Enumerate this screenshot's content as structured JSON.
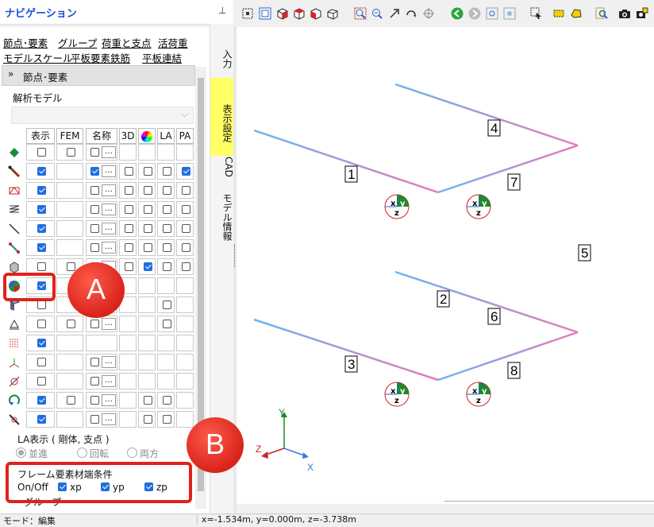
{
  "nav": {
    "title": "ナビゲーション",
    "pin": "ª",
    "menu": [
      "節点･要素",
      "グループ",
      "荷重と支点",
      "活荷重",
      "モデルスケール",
      "平板要素鉄筋",
      "平板連結"
    ],
    "section_title": "節点･要素",
    "model_label": "解析モデル",
    "model_value": "",
    "columns": [
      "表示",
      "FEM",
      "名称",
      "3D",
      "",
      "LA",
      "PA"
    ],
    "rows": [
      {
        "icon": "node-icon",
        "disp": false,
        "fem": false,
        "name": false,
        "threed": null,
        "color": null,
        "la": null,
        "pa": null
      },
      {
        "icon": "frame-element-icon",
        "disp": true,
        "fem": null,
        "name": true,
        "threed": false,
        "color": false,
        "la": false,
        "pa": true
      },
      {
        "icon": "truss-icon",
        "disp": true,
        "fem": null,
        "name": false,
        "threed": false,
        "color": false,
        "la": false,
        "pa": false
      },
      {
        "icon": "spring-icon",
        "disp": true,
        "fem": null,
        "name": false,
        "threed": false,
        "color": false,
        "la": false,
        "pa": false
      },
      {
        "icon": "cable-icon",
        "disp": true,
        "fem": null,
        "name": false,
        "threed": false,
        "color": false,
        "la": false,
        "pa": false
      },
      {
        "icon": "link-icon",
        "disp": true,
        "fem": null,
        "name": false,
        "threed": false,
        "color": false,
        "la": false,
        "pa": false
      },
      {
        "icon": "solid-icon",
        "disp": false,
        "fem": false,
        "name": false,
        "threed": false,
        "color": true,
        "la": false,
        "pa": false
      },
      {
        "icon": "local-axis-icon",
        "disp": true,
        "fem": null,
        "name": null,
        "threed": null,
        "color": null,
        "la": null,
        "pa": null
      },
      {
        "icon": "plate-icon",
        "disp": false,
        "fem": null,
        "name": null,
        "threed": null,
        "color": null,
        "la": false,
        "pa": null
      },
      {
        "icon": "support-icon",
        "disp": false,
        "fem": false,
        "name": false,
        "threed": null,
        "color": null,
        "la": false,
        "pa": null
      },
      {
        "icon": "spring-support-icon",
        "disp": true,
        "fem": null,
        "name": null,
        "threed": null,
        "color": null,
        "la": null,
        "pa": null
      },
      {
        "icon": "axis-icon",
        "disp": false,
        "fem": null,
        "name": false,
        "threed": null,
        "color": null,
        "la": null,
        "pa": null
      },
      {
        "icon": "rigid-icon",
        "disp": false,
        "fem": null,
        "name": false,
        "threed": null,
        "color": null,
        "la": null,
        "pa": null
      },
      {
        "icon": "rotation-icon",
        "disp": true,
        "fem": false,
        "name": false,
        "threed": null,
        "color": false,
        "la": false,
        "pa": null
      },
      {
        "icon": "release-icon",
        "disp": true,
        "fem": null,
        "name": false,
        "threed": null,
        "color": false,
        "la": false,
        "pa": null
      }
    ],
    "la_title": "LA表示 ( 剛体, 支点 )",
    "la_options": [
      "並進",
      "回転",
      "両方"
    ],
    "frame_title": "フレーム要素材端条件",
    "frame_onoff": "On/Off",
    "frame_options": [
      "xp",
      "yp",
      "zp"
    ],
    "next_section": "グループ",
    "vtabs": [
      "入力",
      "表示設定",
      "CAD",
      "モデル情報"
    ]
  },
  "callouts": [
    "A",
    "B"
  ],
  "canvas": {
    "members": [
      "1",
      "2",
      "3",
      "4",
      "5",
      "6",
      "7",
      "8"
    ],
    "axes": {
      "x": "X",
      "y": "Y",
      "z": "Z"
    },
    "local_axes": {
      "x": "x",
      "y": "y",
      "z": "z"
    }
  },
  "status": {
    "mode": "モード：編集",
    "coords": "x=-1.534m, y=0.000m, z=-3.738m"
  },
  "colors": {
    "accent": "#1f6fe0",
    "highlight": "#ffff66",
    "callout": "#e0221a"
  }
}
